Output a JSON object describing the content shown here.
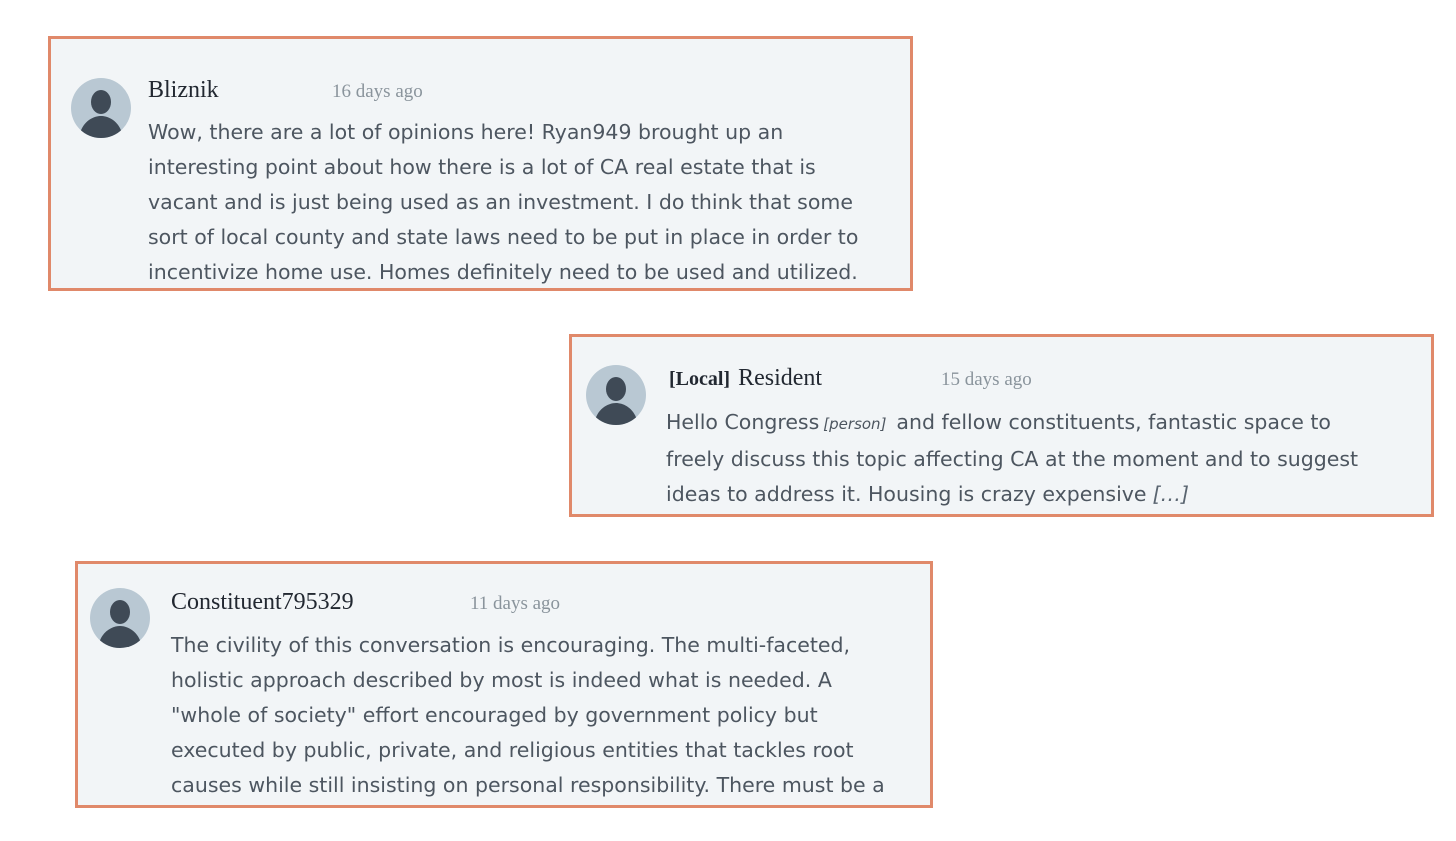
{
  "comments": [
    {
      "author": "Bliznik",
      "timestamp": "16 days ago",
      "lines": [
        "Wow, there are a lot of opinions here! Ryan949 brought up an",
        "interesting point about how there is a lot of CA real estate that is",
        "vacant and is just being used as an investment. I do think that some",
        "sort of local county and state laws need to be put in place in order to",
        "incentivize home use. Homes definitely need to be used and utilized."
      ]
    },
    {
      "author_tag": "[Local]",
      "author": "Resident",
      "timestamp": "15 days ago",
      "line1_before": "Hello Congress",
      "line1_redaction": "[person]",
      "line1_after": "and fellow constituents, fantastic space to",
      "line2": "freely discuss this topic affecting CA at the moment and to suggest",
      "line3": "ideas to address it. Housing is crazy expensive",
      "truncation": "[…]"
    },
    {
      "author": "Constituent795329",
      "timestamp": "11 days ago",
      "lines": [
        "The civility of this conversation is encouraging. The multi-faceted,",
        "holistic approach described by most is indeed what is needed. A",
        "\"whole of society\" effort encouraged by government policy but",
        "executed by public, private, and religious entities that tackles root",
        "causes while still insisting on personal responsibility. There must be a"
      ]
    }
  ],
  "icons": {
    "avatar": "user-silhouette-icon"
  },
  "colors": {
    "card_border": "#e0896a",
    "card_background": "#f2f5f7",
    "avatar_background": "#b9c8d3",
    "avatar_figure": "#3f4a56"
  }
}
